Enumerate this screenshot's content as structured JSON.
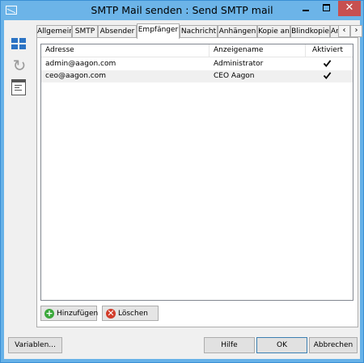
{
  "window": {
    "title": "SMTP Mail senden : Send SMTP mail",
    "close_glyph": "✕"
  },
  "tabs": [
    {
      "label": "Allgemein"
    },
    {
      "label": "SMTP"
    },
    {
      "label": "Absender"
    },
    {
      "label": "Empfänger",
      "active": true
    },
    {
      "label": "Nachricht"
    },
    {
      "label": "Anhängen"
    },
    {
      "label": "Kopie an"
    },
    {
      "label": "Blindkopie"
    },
    {
      "label": "An"
    }
  ],
  "tab_scroll": {
    "left": "‹",
    "right": "›"
  },
  "recipients": {
    "columns": [
      "Adresse",
      "Anzeigename",
      "Aktiviert"
    ],
    "rows": [
      {
        "address": "admin@aagon.com",
        "display_name": "Administrator",
        "enabled": true
      },
      {
        "address": "ceo@aagon.com",
        "display_name": "CEO Aagon",
        "enabled": true
      }
    ]
  },
  "panel_buttons": {
    "add_label": "Hinzufügen",
    "delete_label": "Löschen"
  },
  "footer": {
    "variables_label": "Variablen...",
    "help_label": "Hilfe",
    "ok_label": "OK",
    "cancel_label": "Abbrechen"
  },
  "colors": {
    "title_bar": "#6cb4e8",
    "close_button": "#c75050",
    "add_icon": "#3aa83a",
    "delete_icon": "#d23c2a"
  },
  "icons": [
    "mail-icon",
    "windows-icon",
    "refresh-icon",
    "report-icon",
    "add-icon",
    "delete-icon",
    "checkbox-checked-icon"
  ]
}
